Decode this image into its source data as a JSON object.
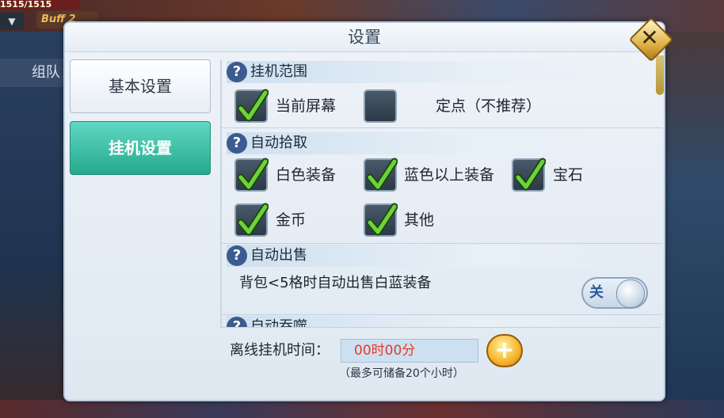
{
  "hud": {
    "hp_text": "1515/1515",
    "buff_label": "Buff 2",
    "dropdown_glyph": "▼",
    "team_label": "组队"
  },
  "dialog": {
    "title": "设置",
    "close_glyph": "✕"
  },
  "tabs": [
    {
      "label": "基本设置",
      "active": false
    },
    {
      "label": "挂机设置",
      "active": true
    }
  ],
  "sections": {
    "range": {
      "title": "挂机范围",
      "options": [
        {
          "label": "当前屏幕",
          "checked": true
        },
        {
          "label": "定点（不推荐）",
          "checked": false
        }
      ]
    },
    "pickup": {
      "title": "自动拾取",
      "options": [
        {
          "label": "白色装备",
          "checked": true
        },
        {
          "label": "蓝色以上装备",
          "checked": true
        },
        {
          "label": "宝石",
          "checked": true
        },
        {
          "label": "金币",
          "checked": true
        },
        {
          "label": "其他",
          "checked": true
        }
      ]
    },
    "sell": {
      "title": "自动出售",
      "description": "背包<5格时自动出售白蓝装备",
      "toggle_label": "关",
      "toggle_on": false
    },
    "devour": {
      "title": "自动吞噬"
    }
  },
  "offline": {
    "label": "离线挂机时间：",
    "value": "00时00分",
    "note": "（最多可储备20个小时）",
    "add_glyph": "+"
  },
  "colors": {
    "active_tab": "#25a98e",
    "check": "#6fd23a",
    "time_value": "#e23a2a",
    "toggle_text": "#2a5a9a"
  }
}
